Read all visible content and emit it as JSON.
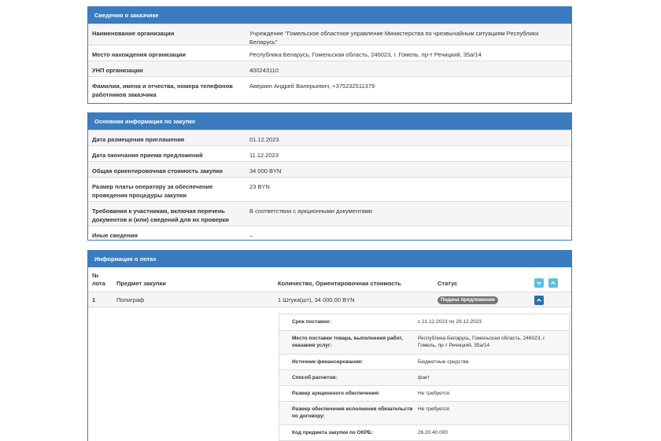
{
  "customer": {
    "title": "Сведения о заказчике",
    "rows": [
      {
        "label": "Наименование организации",
        "value": "Учреждение \"Гомельское областное управление Министерства по чрезвычайным ситуациям Республики Беларусь\""
      },
      {
        "label": "Место нахождения организации",
        "value": "Республика Беларусь, Гомельская область, 246023, г. Гомель, пр-т Речицкий, 35а/14"
      },
      {
        "label": "УНП организации",
        "value": "400243110"
      },
      {
        "label": "Фамилии, имена и отчества, номера телефонов работников заказчика",
        "value": "Аверкин Андрей Валерьевич, +375232511379"
      }
    ]
  },
  "procurement": {
    "title": "Основная информация по закупке",
    "rows": [
      {
        "label": "Дата размещения приглашения",
        "value": "01.12.2023"
      },
      {
        "label": "Дата окончания приема предложений",
        "value": "11.12.2023"
      },
      {
        "label": "Общая ориентировочная стоимость закупки",
        "value": "34 000 BYN"
      },
      {
        "label": "Размер платы оператору за обеспечение проведения процедуры закупки",
        "value": "23 BYN"
      },
      {
        "label": "Требования к участникам, включая перечень документов и (или) сведений для их проверки",
        "value": "В соответствии с аукционными документами"
      },
      {
        "label": "Иные сведения",
        "value": "–"
      }
    ]
  },
  "lots": {
    "title": "Информация о лотах",
    "columns": {
      "number": "№ лота",
      "subject": "Предмет закупки",
      "quantity": "Количество, Ориентировочная стоимость",
      "status": "Статус"
    },
    "expand_all_icon": "chevron-down-icon",
    "collapse_all_icon": "chevron-up-icon",
    "lot": {
      "number": "1",
      "subject": "Полиграф",
      "quantity": "1 Штука(шт), 34 000.00 BYN",
      "status": "Подача предложения",
      "collapse_icon": "chevron-up-icon"
    },
    "details": [
      {
        "label": "Срок поставки:",
        "value": "с 21.12.2023 по 29.12.2023"
      },
      {
        "label": "Место поставки товара, выполнения работ, оказания услуг:",
        "value": "Республика Беларусь, Гомельская область, 246023, г. Гомель, пр-т Речицкий, 35а/14"
      },
      {
        "label": "Источник финансирования:",
        "value": "Бюджетные средства"
      },
      {
        "label": "Способ расчетов:",
        "value": "факт"
      },
      {
        "label": "Размер аукционного обеспечения:",
        "value": "Не требуется"
      },
      {
        "label": "Размер обеспечения исполнения обязательств по договору:",
        "value": "Не требуется"
      },
      {
        "label": "Код предмета закупки по ОКРБ:",
        "value": "26.20.40.000"
      }
    ]
  },
  "colors": {
    "panel_header": "#3a7cbf",
    "badge": "#777777",
    "button_light": "#5bc0de",
    "button_dark": "#2e6da4"
  }
}
